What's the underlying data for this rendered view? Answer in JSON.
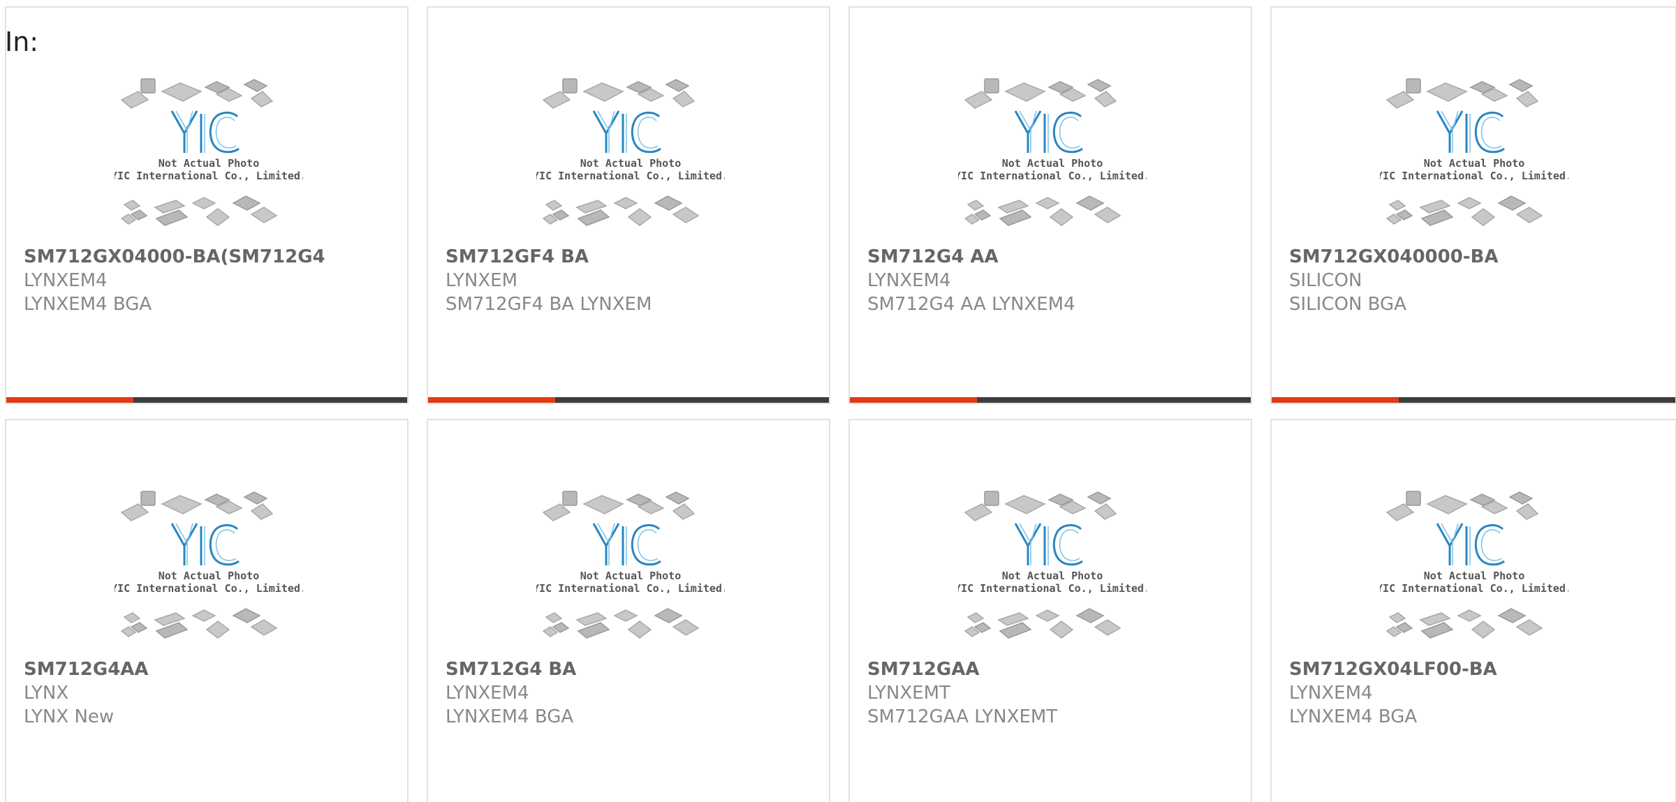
{
  "header": {
    "in_label": "In:"
  },
  "placeholder": {
    "line1": "Not Actual Photo",
    "line2": "YIC International Co., Limited."
  },
  "colors": {
    "accent": "#e23b14",
    "bar": "#3d3d3d",
    "logo": "#2a86c0"
  },
  "cards": [
    {
      "part": "SM712GX04000-BA(SM712G4",
      "brand": "LYNXEM4",
      "desc": "LYNXEM4 BGA"
    },
    {
      "part": "SM712GF4 BA",
      "brand": "LYNXEM",
      "desc": "SM712GF4 BA LYNXEM"
    },
    {
      "part": "SM712G4 AA",
      "brand": "LYNXEM4",
      "desc": "SM712G4 AA LYNXEM4"
    },
    {
      "part": "SM712GX040000-BA",
      "brand": "SILICON",
      "desc": "SILICON BGA"
    },
    {
      "part": "SM712G4AA",
      "brand": "LYNX",
      "desc": "LYNX New"
    },
    {
      "part": "SM712G4 BA",
      "brand": "LYNXEM4",
      "desc": "LYNXEM4 BGA"
    },
    {
      "part": "SM712GAA",
      "brand": "LYNXEMT",
      "desc": "SM712GAA LYNXEMT"
    },
    {
      "part": "SM712GX04LF00-BA",
      "brand": "LYNXEM4",
      "desc": "LYNXEM4 BGA"
    }
  ]
}
